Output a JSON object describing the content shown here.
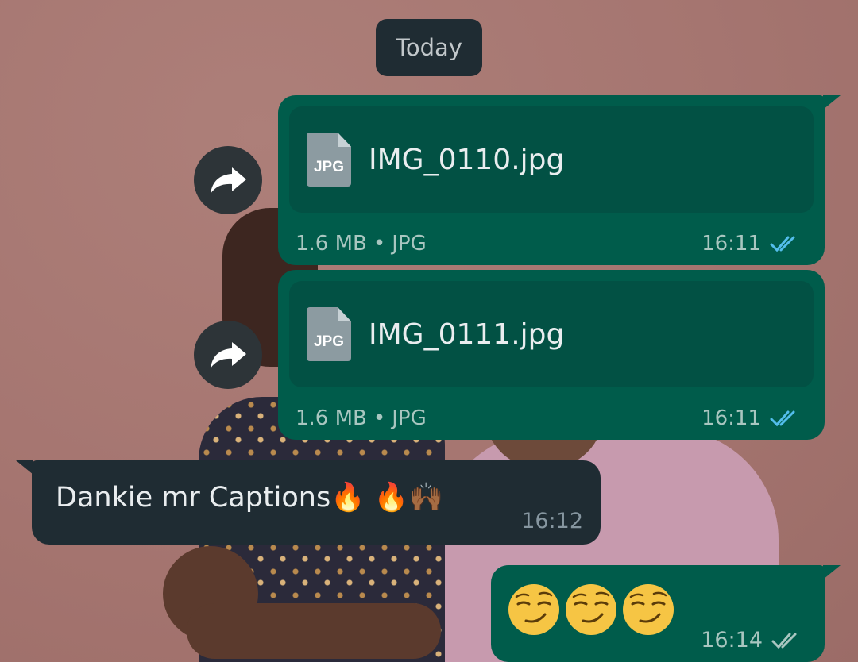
{
  "date_separator": "Today",
  "messages": [
    {
      "type": "document",
      "direction": "outgoing",
      "file_name": "IMG_0110.jpg",
      "file_type_badge": "JPG",
      "size": "1.6 MB",
      "kind": "JPG",
      "time": "16:11",
      "status": "read"
    },
    {
      "type": "document",
      "direction": "outgoing",
      "file_name": "IMG_0111.jpg",
      "file_type_badge": "JPG",
      "size": "1.6 MB",
      "kind": "JPG",
      "time": "16:11",
      "status": "read"
    },
    {
      "type": "text",
      "direction": "incoming",
      "text": "Dankie mr Captions🔥 🔥🙌🏾",
      "time": "16:12"
    },
    {
      "type": "emoji",
      "direction": "outgoing",
      "emoji": [
        "smirking-face",
        "smirking-face",
        "smirking-face"
      ],
      "time": "16:14",
      "status": "delivered"
    }
  ],
  "separator_dot": "•",
  "icons": {
    "forward": "forward-arrow-icon",
    "read_ticks": "double-check-icon"
  },
  "colors": {
    "outgoing_bubble": "#005c4b",
    "incoming_bubble": "#1f2c33",
    "read_ticks": "#53bdeb",
    "delivered_ticks": "#a9c6c0"
  }
}
